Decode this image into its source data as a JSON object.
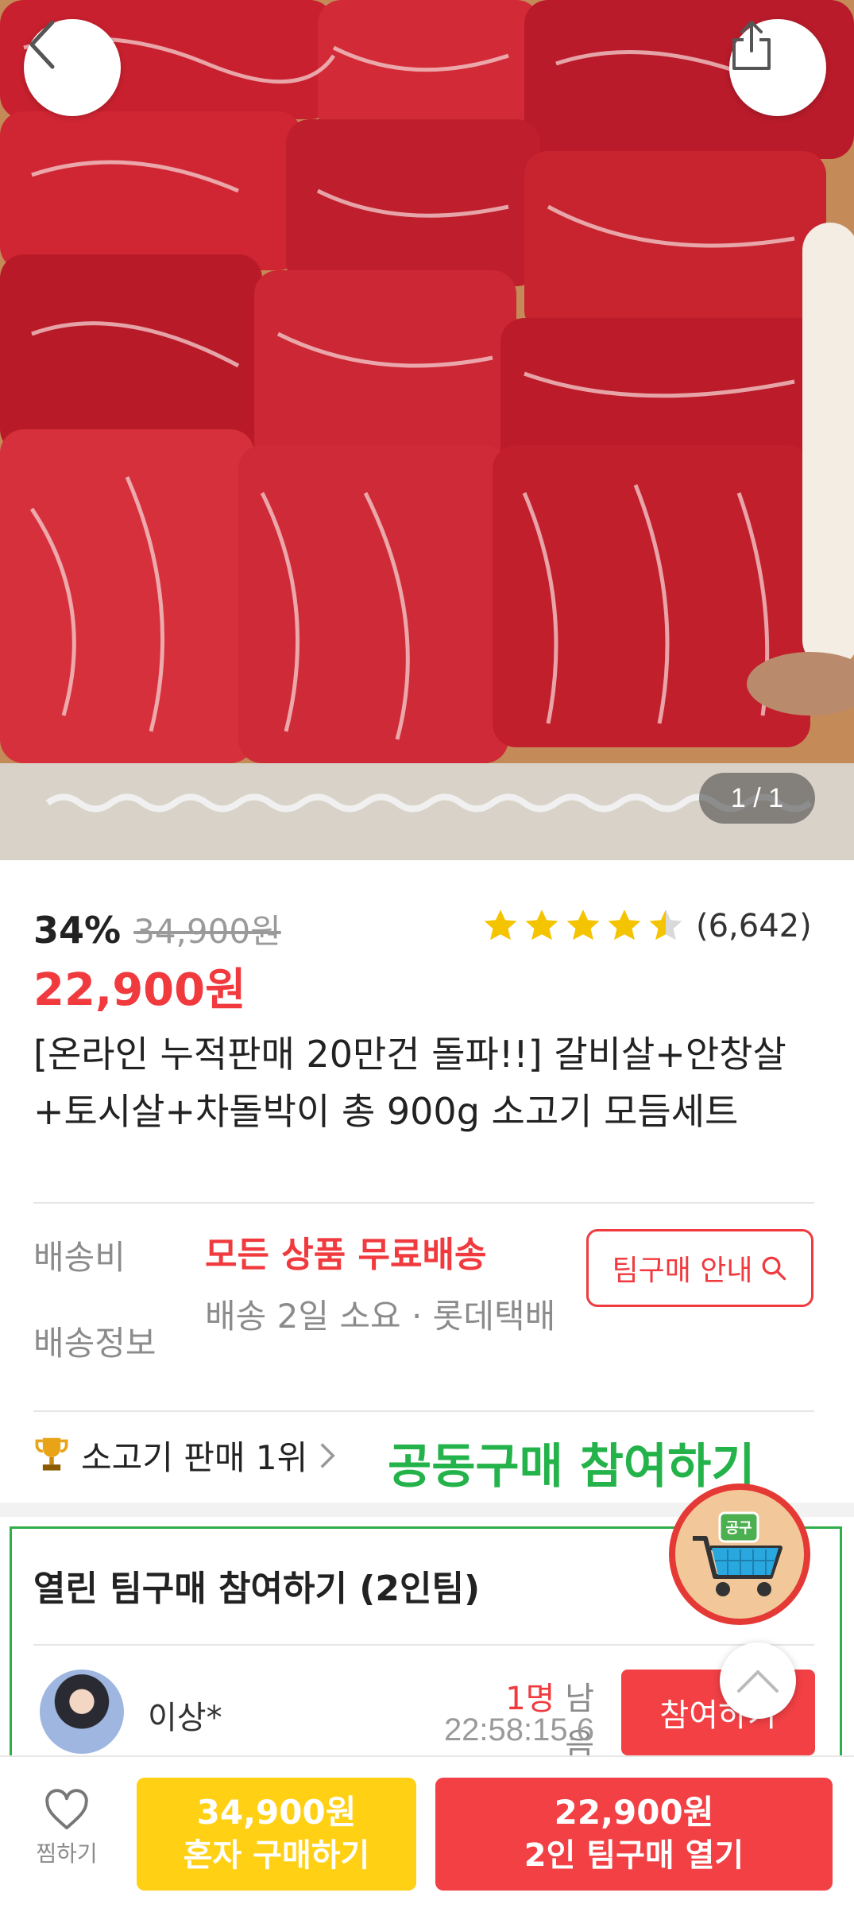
{
  "hero": {
    "pager": "1 / 1"
  },
  "product": {
    "discount": "34%",
    "original_price": "34,900원",
    "sale_price": "22,900원",
    "rating": 4.5,
    "review_count": "(6,642)",
    "title": "[온라인 누적판매 20만건 돌파!!] 갈비살+안창살+토시살+차돌박이 총 900g 소고기 모듬세트"
  },
  "shipping": {
    "fee_label": "배송비",
    "fee_value": "모든 상품 무료배송",
    "info_label": "배송정보",
    "info_value": "배송 2일 소요 · 롯데택배",
    "team_guide_label": "팀구매 안내"
  },
  "rank": {
    "text": "소고기 판매 1위",
    "join_cta": "공동구매 참여하기"
  },
  "team": {
    "heading": "열린 팀구매 참여하기 (2인팀)",
    "member_name": "이상*",
    "remaining_count": "1명",
    "remaining_suffix": " 남음",
    "timer": "22:58:15.6",
    "join_label": "참여하기"
  },
  "bottom": {
    "wish_label": "찜하기",
    "solo_price": "34,900원",
    "solo_label": "혼자 구매하기",
    "team_price": "22,900원",
    "team_label": "2인 팀구매 열기"
  },
  "cart_badge": "공구",
  "colors": {
    "accent_red": "#f03a3e",
    "accent_green": "#24b34a",
    "star_yellow": "#f5c400",
    "solo_yellow": "#ffd014"
  },
  "icons": [
    "back-icon",
    "share-icon",
    "star-icon",
    "search-icon",
    "trophy-icon",
    "chevron-right-icon",
    "cart-icon",
    "chevron-up-icon",
    "heart-icon"
  ]
}
